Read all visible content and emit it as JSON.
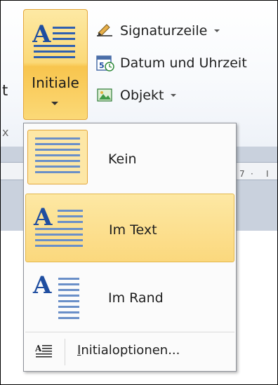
{
  "ribbon": {
    "cut_left_text": "t",
    "cut_left_text_2": "x",
    "initiale_label": "Initiale",
    "items": [
      {
        "label": "Signaturzeile",
        "icon": "signature-line-icon",
        "has_dropdown": true
      },
      {
        "label": "Datum und Uhrzeit",
        "icon": "date-time-icon",
        "has_dropdown": false
      },
      {
        "label": "Objekt",
        "icon": "object-icon",
        "has_dropdown": true
      }
    ]
  },
  "ruler": {
    "ticks": [
      "7",
      "·",
      "I"
    ]
  },
  "menu": {
    "options": [
      {
        "label": "Kein",
        "icon": "drop-cap-none-icon",
        "selected": true
      },
      {
        "label": "Im Text",
        "icon": "drop-cap-in-text-icon",
        "hovered": true
      },
      {
        "label": "Im Rand",
        "icon": "drop-cap-in-margin-icon"
      }
    ],
    "footer": {
      "label_underlined": "I",
      "label_rest": "nitialoptionen...",
      "icon": "drop-cap-options-icon"
    }
  },
  "colors": {
    "hover_fill": "#fbd87d",
    "hover_border": "#e3b74c",
    "line_blue": "#6a8fc8",
    "letter_blue": "#1f4ea0"
  }
}
